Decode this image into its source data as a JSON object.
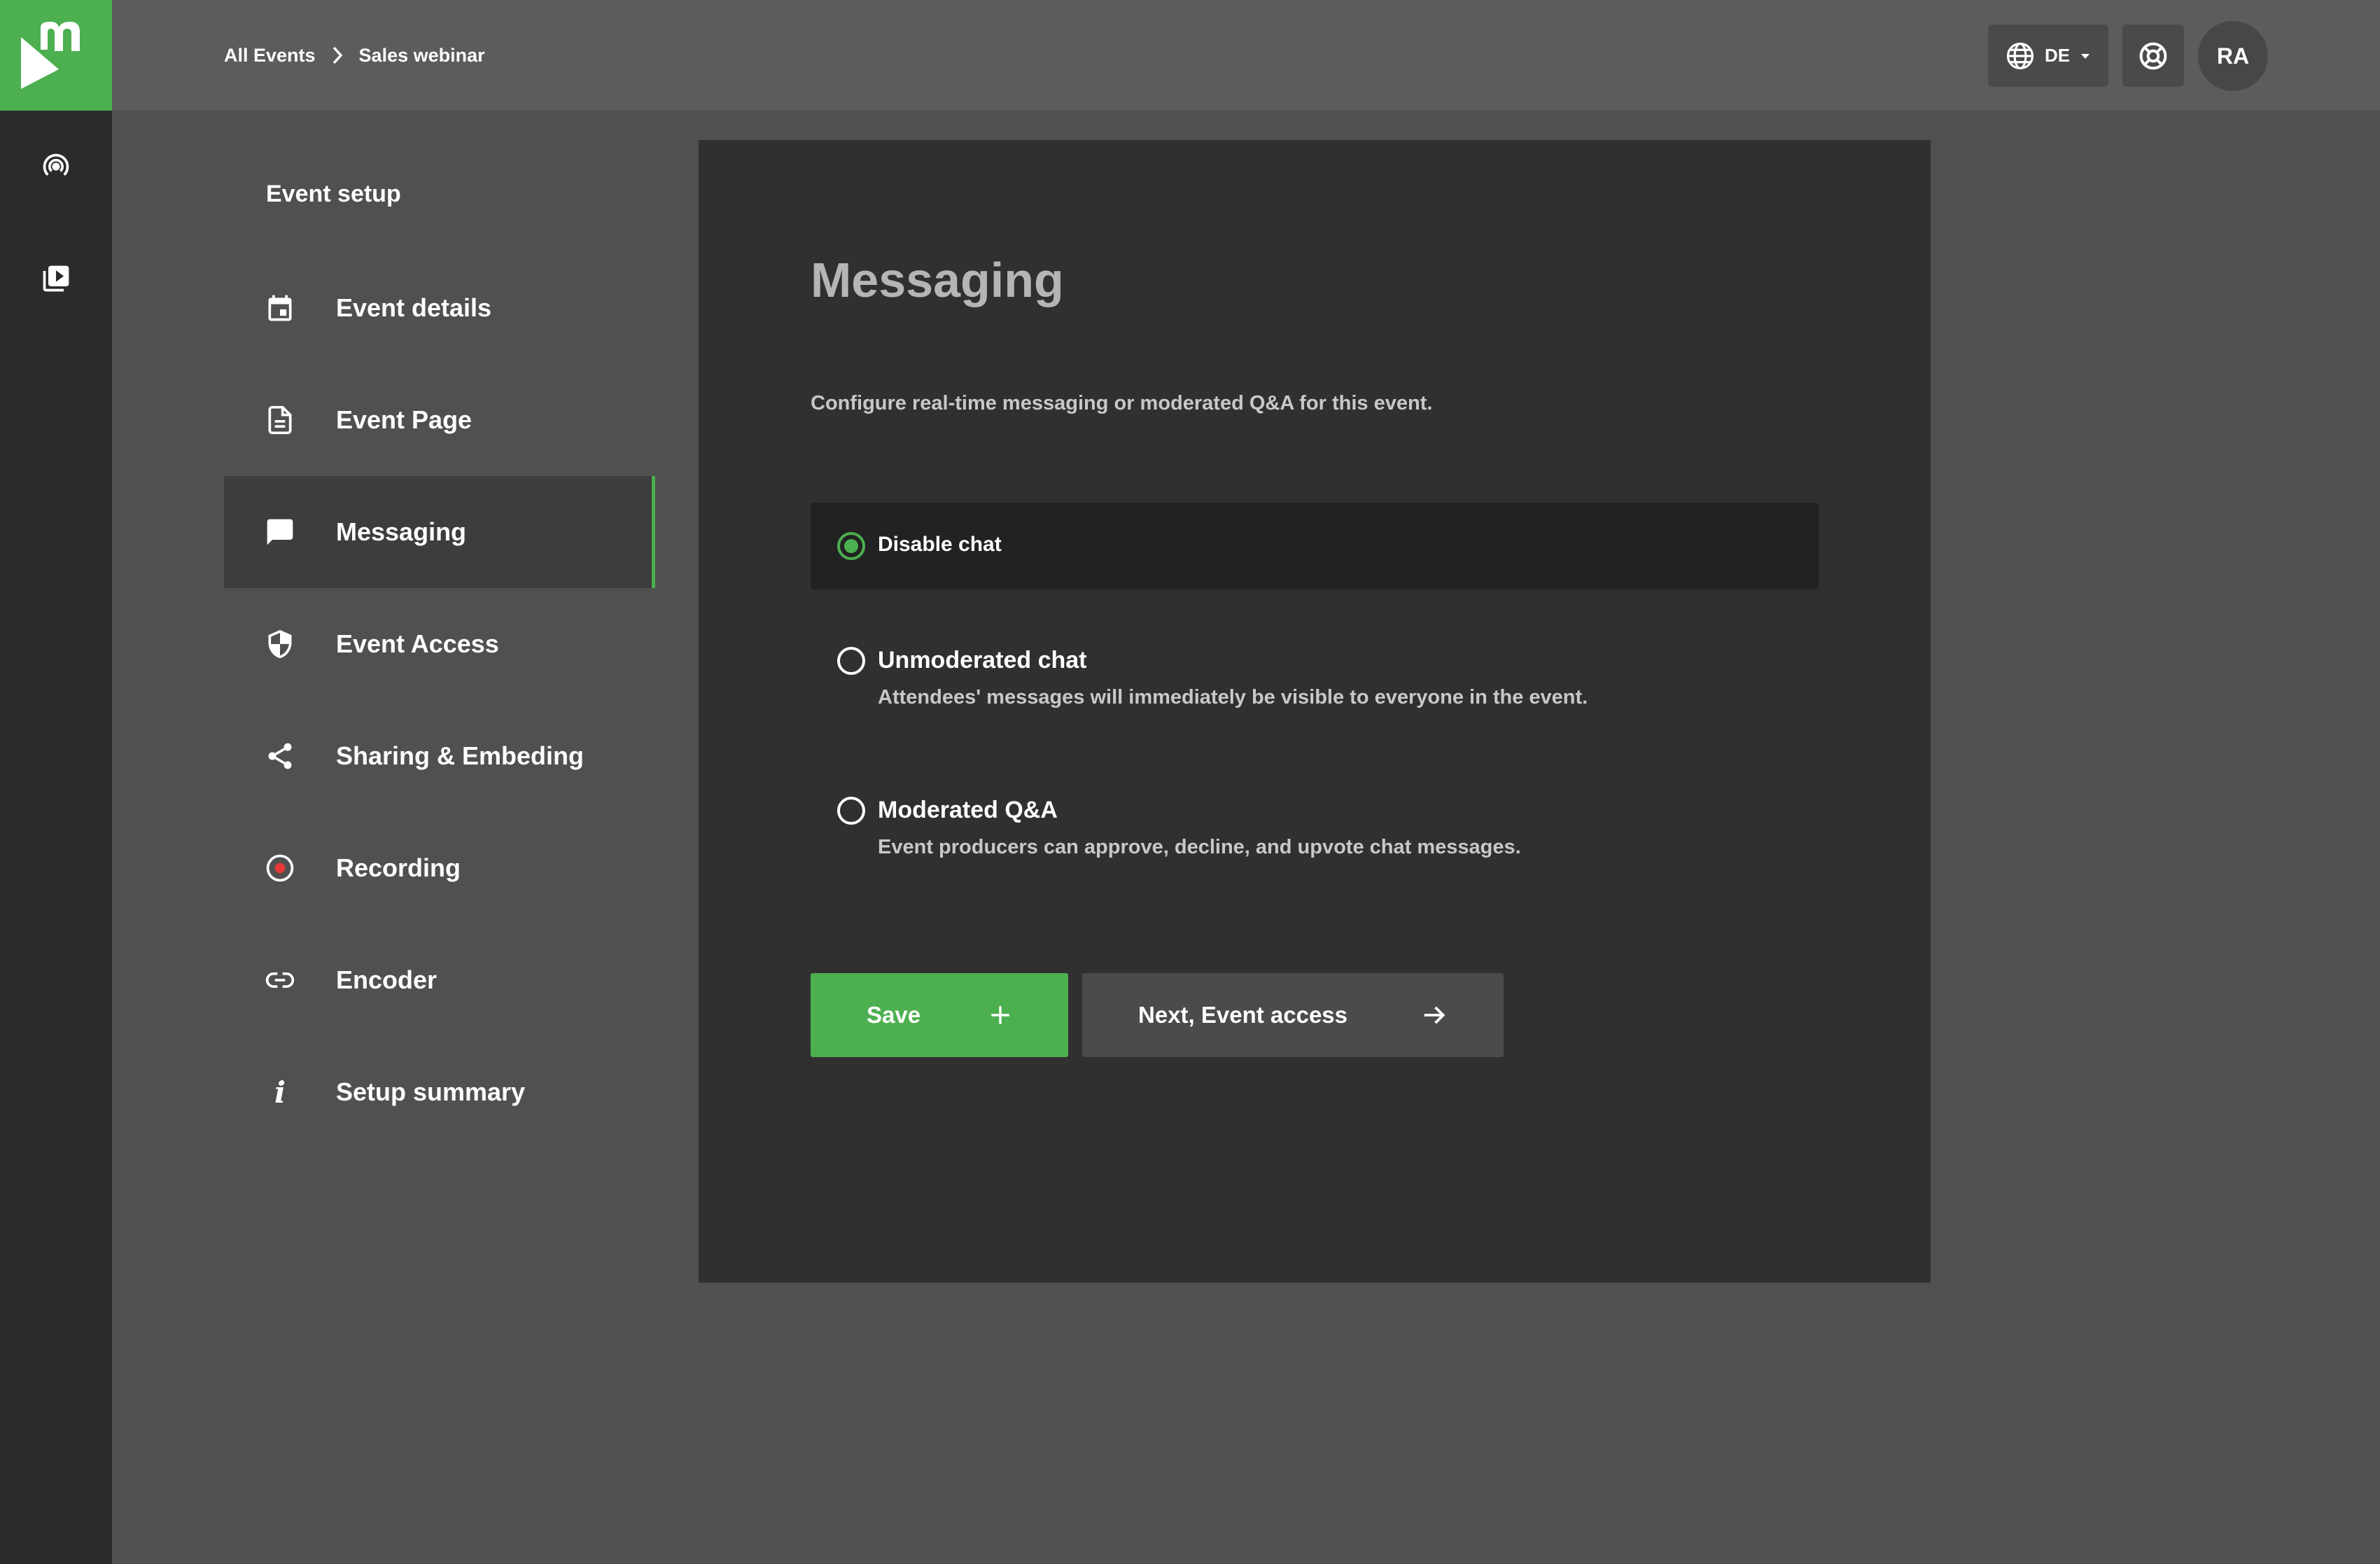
{
  "breadcrumb": {
    "root": "All Events",
    "current": "Sales webinar"
  },
  "header": {
    "language": "DE",
    "avatar_initials": "RA"
  },
  "nav": {
    "title": "Event setup",
    "items": [
      {
        "label": "Event details",
        "icon": "calendar-icon"
      },
      {
        "label": "Event Page",
        "icon": "document-icon"
      },
      {
        "label": "Messaging",
        "icon": "chat-icon",
        "active": true
      },
      {
        "label": "Event Access",
        "icon": "shield-icon"
      },
      {
        "label": "Sharing & Embeding",
        "icon": "share-icon"
      },
      {
        "label": "Recording",
        "icon": "record-icon"
      },
      {
        "label": "Encoder",
        "icon": "link-icon"
      },
      {
        "label": "Setup summary",
        "icon": "info-icon"
      }
    ]
  },
  "main": {
    "title": "Messaging",
    "description": "Configure real-time messaging or moderated Q&A for this event.",
    "options": [
      {
        "label": "Disable chat",
        "description": "",
        "selected": true
      },
      {
        "label": "Unmoderated chat",
        "description": "Attendees' messages will immediately be visible to everyone in the event.",
        "selected": false
      },
      {
        "label": "Moderated Q&A",
        "description": "Event producers can approve, decline, and upvote chat messages.",
        "selected": false
      }
    ],
    "save_label": "Save",
    "next_label": "Next, Event access"
  },
  "colors": {
    "accent": "#4caf50",
    "panel": "#303030",
    "background": "#505050",
    "rail": "#2b2b2b"
  }
}
